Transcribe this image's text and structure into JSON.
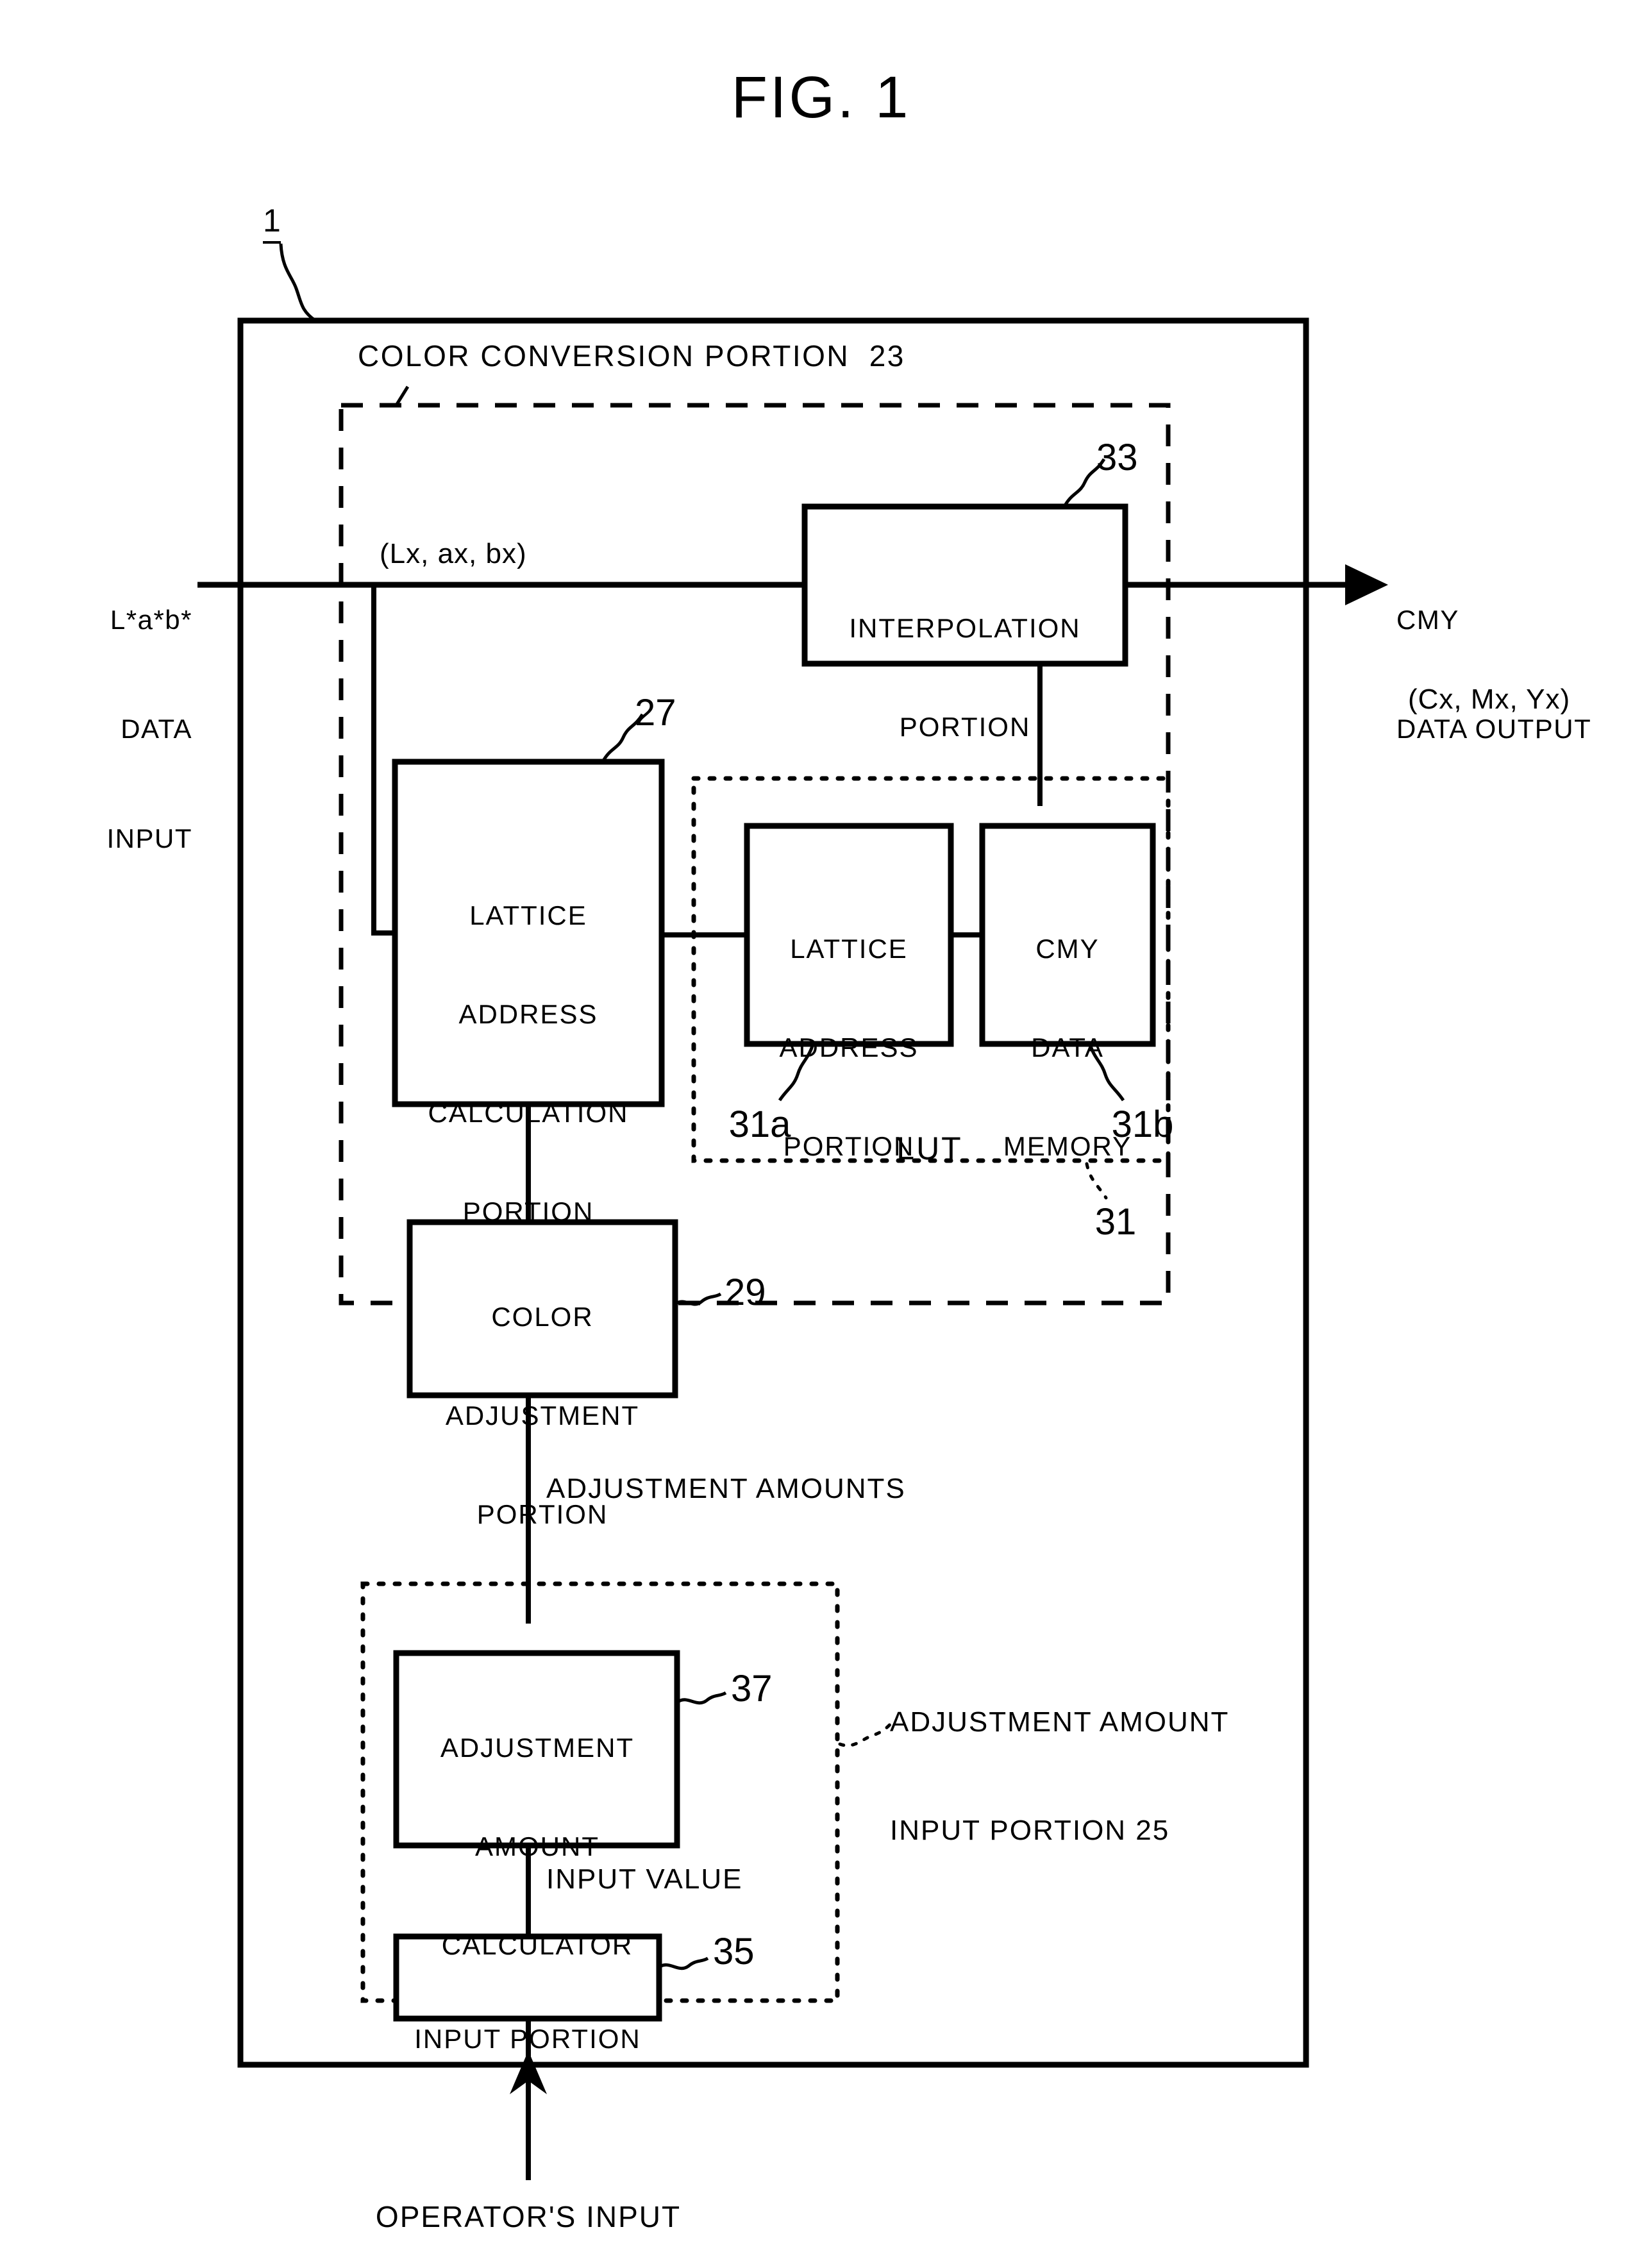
{
  "figure": {
    "title": "FIG. 1",
    "outer_ref": "1"
  },
  "io": {
    "input_label": "L*a*b*\nDATA\nINPUT",
    "input_signal": "(Lx, ax, bx)",
    "output_label": "CMY\nDATA OUTPUT",
    "output_signal": "(Cx, Mx, Yx)",
    "operator_input": "OPERATOR'S INPUT"
  },
  "sections": {
    "color_conversion": {
      "label": "COLOR CONVERSION PORTION  23",
      "ref": "23"
    },
    "adjustment_input": {
      "label_line1": "ADJUSTMENT AMOUNT",
      "label_line2": "INPUT PORTION 25",
      "ref": "25"
    },
    "lut": {
      "label": "LUT",
      "ref": "31"
    }
  },
  "blocks": [
    {
      "id": "interpolation-portion",
      "lines": [
        "INTERPOLATION",
        "PORTION"
      ],
      "ref": "33"
    },
    {
      "id": "lattice-address-calculation-portion",
      "lines": [
        "LATTICE",
        "ADDRESS",
        "CALCULATION",
        "PORTION"
      ],
      "ref": "27"
    },
    {
      "id": "lattice-address-portion",
      "lines": [
        "LATTICE",
        "ADDRESS",
        "PORTION"
      ],
      "ref": "31a"
    },
    {
      "id": "cmy-data-memory",
      "lines": [
        "CMY",
        "DATA",
        "MEMORY"
      ],
      "ref": "31b"
    },
    {
      "id": "color-adjustment-portion",
      "lines": [
        "COLOR",
        "ADJUSTMENT",
        "PORTION"
      ],
      "ref": "29"
    },
    {
      "id": "adjustment-amount-calculator",
      "lines": [
        "ADJUSTMENT",
        "AMOUNT",
        "CALCULATOR"
      ],
      "ref": "37"
    },
    {
      "id": "input-portion",
      "lines": [
        "INPUT PORTION"
      ],
      "ref": "35"
    }
  ],
  "signals": {
    "adjustment_amounts": "ADJUSTMENT AMOUNTS",
    "input_value": "INPUT VALUE"
  },
  "block_text": {
    "interpolation_l1": "INTERPOLATION",
    "interpolation_l2": "PORTION",
    "lattice_calc_l1": "LATTICE",
    "lattice_calc_l2": "ADDRESS",
    "lattice_calc_l3": "CALCULATION",
    "lattice_calc_l4": "PORTION",
    "lattice_addr_l1": "LATTICE",
    "lattice_addr_l2": "ADDRESS",
    "lattice_addr_l3": "PORTION",
    "cmy_mem_l1": "CMY",
    "cmy_mem_l2": "DATA",
    "cmy_mem_l3": "MEMORY",
    "color_adj_l1": "COLOR",
    "color_adj_l2": "ADJUSTMENT",
    "color_adj_l3": "PORTION",
    "adj_calc_l1": "ADJUSTMENT",
    "adj_calc_l2": "AMOUNT",
    "adj_calc_l3": "CALCULATOR",
    "input_portion_l1": "INPUT PORTION"
  },
  "refs": {
    "r1": "1",
    "r23": "COLOR CONVERSION PORTION  23",
    "r25_l1": "ADJUSTMENT AMOUNT",
    "r25_l2": "INPUT PORTION 25",
    "r27": "27",
    "r29": "29",
    "r31": "31",
    "r31a": "31a",
    "r31b": "31b",
    "r33": "33",
    "r35": "35",
    "r37": "37",
    "lut": "LUT"
  },
  "io_text": {
    "in_l1": "L*a*b*",
    "in_l2": "DATA",
    "in_l3": "INPUT",
    "in_signal": "(Lx, ax, bx)",
    "out_l1": "CMY",
    "out_l2": "DATA OUTPUT",
    "out_signal": "(Cx, Mx, Yx)",
    "operator": "OPERATOR'S INPUT"
  },
  "colors": {
    "ink": "#000000",
    "paper": "#ffffff"
  }
}
